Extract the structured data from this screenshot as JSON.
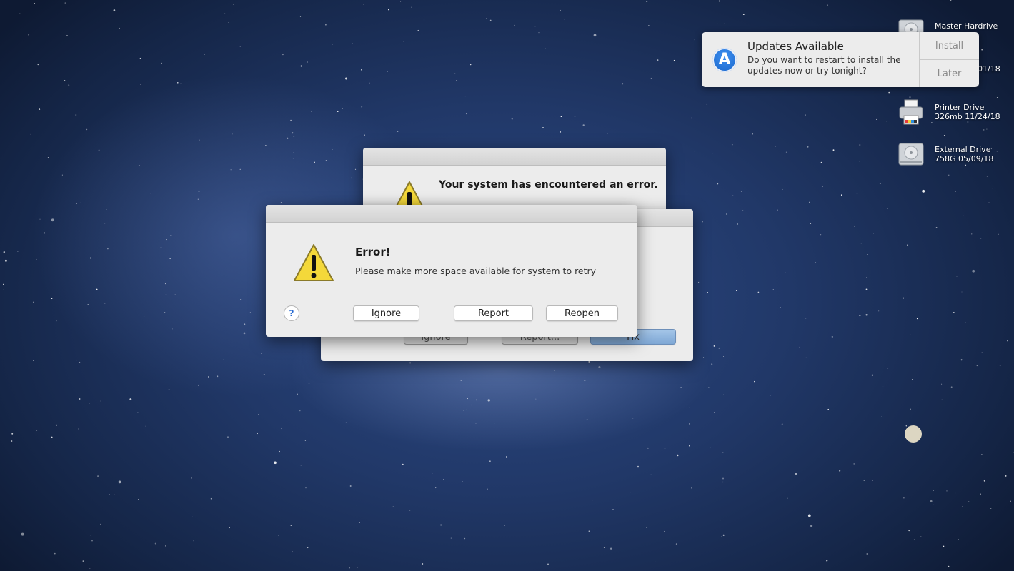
{
  "desktop": {
    "icons": [
      {
        "name": "Master Hardrive",
        "detail": "·· ·· ·· ·/18"
      },
      {
        "name": "",
        "detail": "01/18"
      },
      {
        "name": "Printer Drive",
        "detail": "326mb  11/24/18"
      },
      {
        "name": "External Drive",
        "detail": "758G  05/09/18"
      }
    ]
  },
  "notification": {
    "app_icon": "app-store-icon",
    "title": "Updates Available",
    "body": "Do you want to restart to install the updates now or try tonight?",
    "actions": {
      "install": "Install",
      "later": "Later"
    }
  },
  "back_dialog": {
    "message": "Your system has encountered an error."
  },
  "middle_dialog": {
    "buttons": {
      "ignore": "Ignore",
      "report": "Report...",
      "fix": "Fix"
    }
  },
  "front_dialog": {
    "title": "Error!",
    "message": "Please make more space available for system to retry",
    "help": "?",
    "buttons": {
      "ignore": "Ignore",
      "report": "Report",
      "reopen": "Reopen"
    }
  },
  "colors": {
    "accent": "#1764c9",
    "warning": "#f4d83a"
  }
}
